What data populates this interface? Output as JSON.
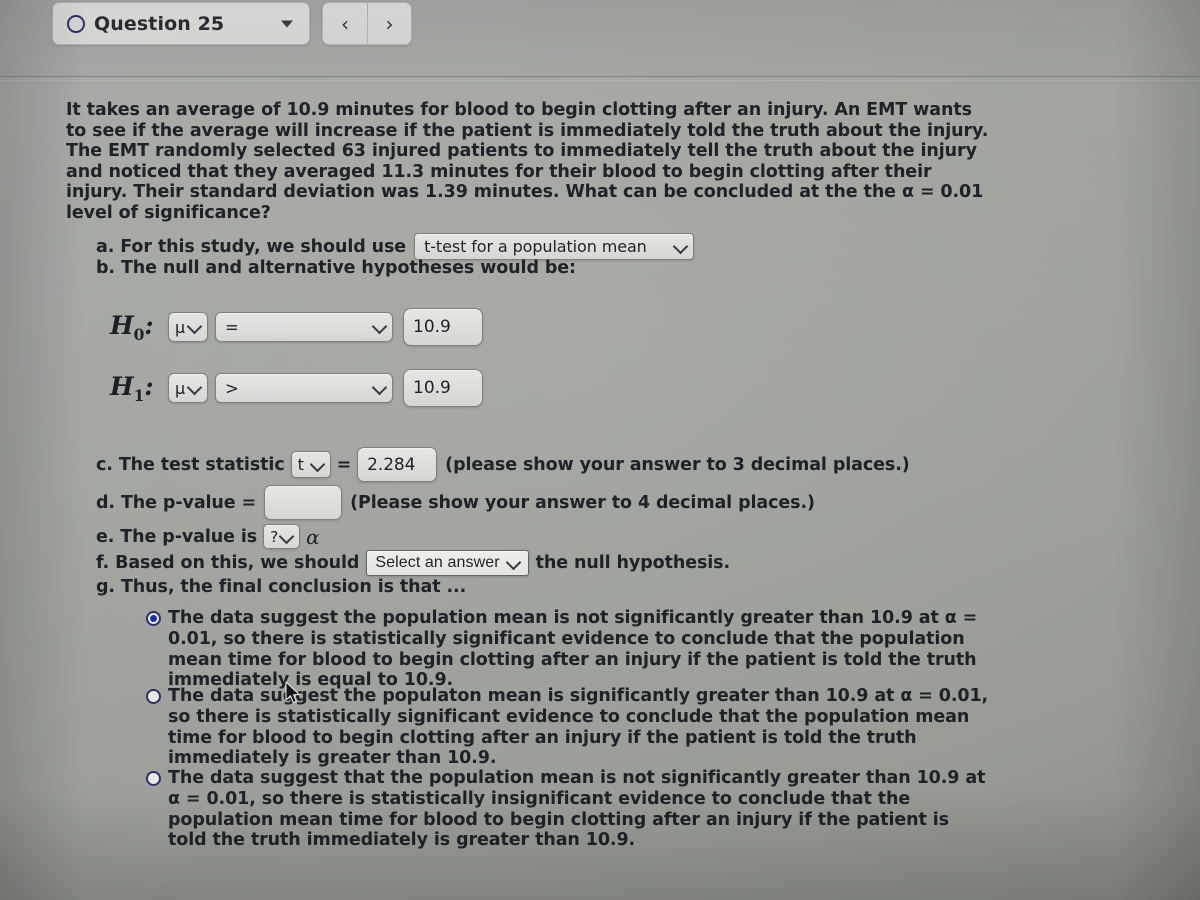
{
  "header": {
    "question_label": "Question 25",
    "dropdown_caret": "caret-down-icon",
    "prev_label": "‹",
    "next_label": "›"
  },
  "question": {
    "stem": "It takes an average of 10.9 minutes for blood to begin clotting after an injury.  An EMT wants to see if the average will increase if the patient is immediately told the truth about the injury. The EMT randomly selected 63 injured patients to immediately tell the truth about the injury and noticed that they averaged 11.3 minutes for their blood to begin clotting after their injury. Their standard deviation was 1.39 minutes. What can be concluded at the the α = 0.01 level of significance?"
  },
  "parts": {
    "a_prefix": "a. For this study, we should use",
    "a_value": "t-test for a population mean",
    "b_text": "b. The null and alternative hypotheses would be:",
    "c_prefix": "c. The test statistic",
    "c_stat_symbol": "t",
    "c_equals": "=",
    "c_value": "2.284",
    "c_suffix": "(please show your answer to 3 decimal places.)",
    "d_prefix": "d. The p-value =",
    "d_value": "",
    "d_suffix": "(Please show your answer to 4 decimal places.)",
    "e_prefix": "e. The p-value is",
    "e_compare": "?",
    "e_alpha": "α",
    "f_prefix": "f. Based on this, we should",
    "f_value": "Select an answer",
    "f_suffix": "the null hypothesis.",
    "g_text": "g. Thus, the final conclusion is that ..."
  },
  "hypotheses": [
    {
      "label": "H",
      "sub": "0",
      "param": "μ",
      "operator": "=",
      "value": "10.9"
    },
    {
      "label": "H",
      "sub": "1",
      "param": "μ",
      "operator": ">",
      "value": "10.9"
    }
  ],
  "choices": [
    {
      "selected": true,
      "segments": [
        {
          "t": "The data suggest the population mean is not ",
          "b": false
        },
        {
          "t": "significantly",
          "b": true
        },
        {
          "t": " greater than 10.9 at α = 0.01, so there is statistically significant evidence to conclude that the population mean time for blood to begin clotting after an injury if the patient is told the truth immediately is equal to 10.9.",
          "b": false
        }
      ]
    },
    {
      "selected": false,
      "segments": [
        {
          "t": "The data suggest the populaton mean is ",
          "b": false
        },
        {
          "t": "significantly",
          "b": true
        },
        {
          "t": " greater than 10.9 at α = 0.01, so there is statistically significant evidence to conclude that the population mean time for blood to begin clotting after an injury if the patient is told the truth immediately is greater than 10.9.",
          "b": false
        }
      ]
    },
    {
      "selected": false,
      "segments": [
        {
          "t": "The data suggest that the population mean is not ",
          "b": false
        },
        {
          "t": "significantly",
          "b": true
        },
        {
          "t": " greater than 10.9 at α = 0.01, so there is statistically insignificant evidence to conclude that the population mean time for blood to begin clotting after an injury if the patient is told the truth immediately is greater than 10.9.",
          "b": false
        }
      ]
    }
  ],
  "colors": {
    "selected_radio": "#1b2fa8",
    "radio_border": "#2b2e6a",
    "text": "#1e2127",
    "page_background": "#9ea19a"
  }
}
